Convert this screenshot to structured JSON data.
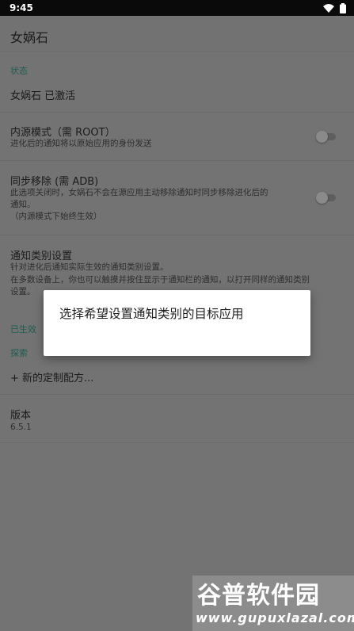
{
  "statusbar": {
    "time": "9:45",
    "icons": [
      "wifi-icon",
      "battery-icon"
    ]
  },
  "appbar": {
    "title": "女娲石"
  },
  "sections": {
    "status": {
      "header": "状态",
      "activated": "女娲石 已激活"
    },
    "inner_mode": {
      "title": "内源模式（需 ROOT）",
      "summary": "进化后的通知将以原始应用的身份发送",
      "enabled": false
    },
    "sync_remove": {
      "title": "同步移除 (需 ADB)",
      "summary_lines": [
        "此选项关闭时，女娲石不会在源应用主动移除通知时同步移除进化后的",
        "通知。",
        "（内源模式下始终生效）"
      ],
      "enabled": false
    },
    "notif_category": {
      "title": "通知类别设置",
      "summary_lines": [
        "针对进化后通知实际生效的通知类别设置。",
        "在多数设备上，你也可以触摸并按住显示于通知栏的通知，以打开同样的通知类别",
        "设置。"
      ]
    },
    "effective": {
      "header": "已生效"
    },
    "explore": {
      "header": "探索",
      "new_recipe": "+ 新的定制配方..."
    },
    "version": {
      "title": "版本",
      "value": "6.5.1"
    }
  },
  "dialog": {
    "title": "选择希望设置通知类别的目标应用"
  },
  "watermark": {
    "line1": "谷普软件园",
    "line2": "www.gupuxlazal.com"
  },
  "colors": {
    "accent": "#1d5d4f",
    "scrim": "#737373",
    "dialog_bg": "#ffffff"
  }
}
